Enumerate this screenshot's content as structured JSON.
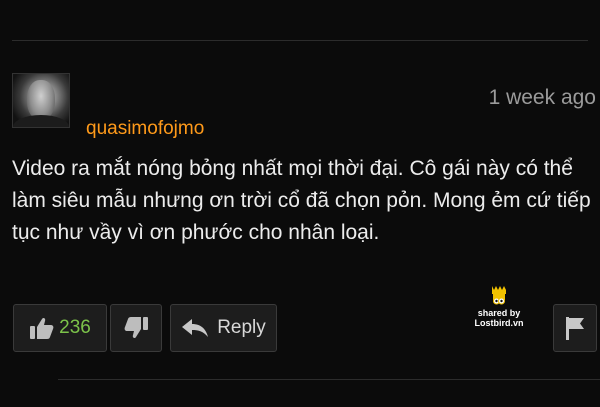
{
  "comment": {
    "username": "quasimofojmo",
    "timestamp": "1 week ago",
    "text": "Video ra mắt nóng bỏng nhất mọi thời đại. Cô gái này có thể làm siêu mẫu nhưng ơn trời cổ đã chọn pỏn. Mong ẻm cứ tiếp tục như vầy vì ơn phước cho nhân loại.",
    "avatar_icon": "user-avatar"
  },
  "actions": {
    "like_count": "236",
    "like_icon": "thumbs-up-icon",
    "dislike_icon": "thumbs-down-icon",
    "reply_label": "Reply",
    "reply_icon": "reply-arrow-icon",
    "flag_icon": "flag-icon"
  },
  "watermark": {
    "line1": "shared by",
    "line2": "Lostbird.vn"
  },
  "colors": {
    "background": "#0b0b0b",
    "username": "#ff9a1a",
    "like_count": "#7cc34a",
    "watermark_bird": "#f2c200"
  }
}
